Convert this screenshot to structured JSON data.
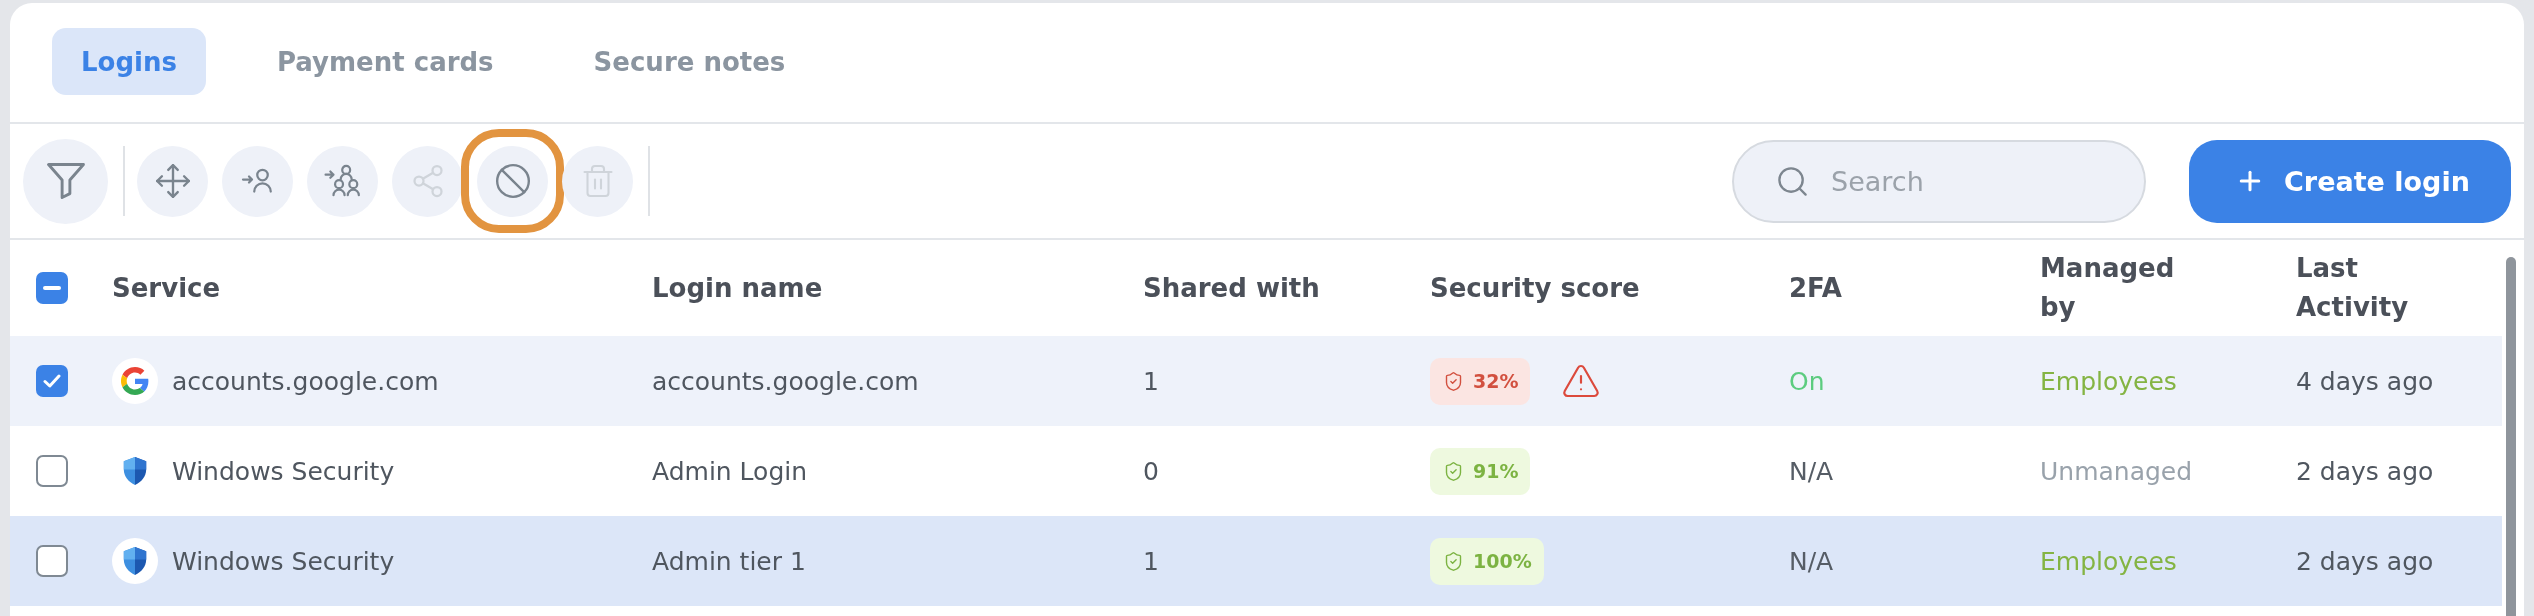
{
  "tabs": [
    {
      "label": "Logins",
      "selected": true
    },
    {
      "label": "Payment cards",
      "selected": false
    },
    {
      "label": "Secure notes",
      "selected": false
    }
  ],
  "toolbar": {
    "groups": [
      [
        {
          "kind": "filter",
          "disabled": false,
          "highlighted": false
        }
      ],
      [
        {
          "kind": "move",
          "disabled": false,
          "highlighted": false
        },
        {
          "kind": "assign-user",
          "disabled": false,
          "highlighted": false
        },
        {
          "kind": "assign-group",
          "disabled": false,
          "highlighted": false
        },
        {
          "kind": "share",
          "disabled": true,
          "highlighted": false
        },
        {
          "kind": "block",
          "disabled": false,
          "highlighted": true
        },
        {
          "kind": "delete",
          "disabled": true,
          "highlighted": false
        }
      ]
    ],
    "search": {
      "placeholder": "Search"
    },
    "create_button": {
      "label": "Create login"
    }
  },
  "table": {
    "select_all": {
      "mixed": true
    },
    "columns": [
      "Service",
      "Login name",
      "Shared with",
      "Security score",
      "2FA",
      "Managed by",
      "Last Activity"
    ],
    "rows": [
      {
        "checked": true,
        "highlighted": false,
        "service": {
          "kind": "g",
          "name": "accounts.google.com"
        },
        "login_name": "accounts.google.com",
        "shared_with": "1",
        "security": {
          "score": "32%",
          "weak": true,
          "warning": true
        },
        "two_fa": {
          "text": "On",
          "active": true
        },
        "managed_by": {
          "text": "Employees",
          "managed": true
        },
        "last_activity": "4 days ago"
      },
      {
        "checked": false,
        "highlighted": false,
        "service": {
          "kind": "shield",
          "name": "Windows Security"
        },
        "login_name": "Admin Login",
        "shared_with": "0",
        "security": {
          "score": "91%",
          "weak": false,
          "warning": false
        },
        "two_fa": {
          "text": "N/A",
          "active": false
        },
        "managed_by": {
          "text": "Unmanaged",
          "managed": false
        },
        "last_activity": "2 days ago"
      },
      {
        "checked": false,
        "highlighted": true,
        "service": {
          "kind": "shield",
          "name": "Windows Security"
        },
        "login_name": "Admin tier 1",
        "shared_with": "1",
        "security": {
          "score": "100%",
          "weak": false,
          "warning": false
        },
        "two_fa": {
          "text": "N/A",
          "active": false
        },
        "managed_by": {
          "text": "Employees",
          "managed": true
        },
        "last_activity": "2 days ago"
      }
    ]
  }
}
